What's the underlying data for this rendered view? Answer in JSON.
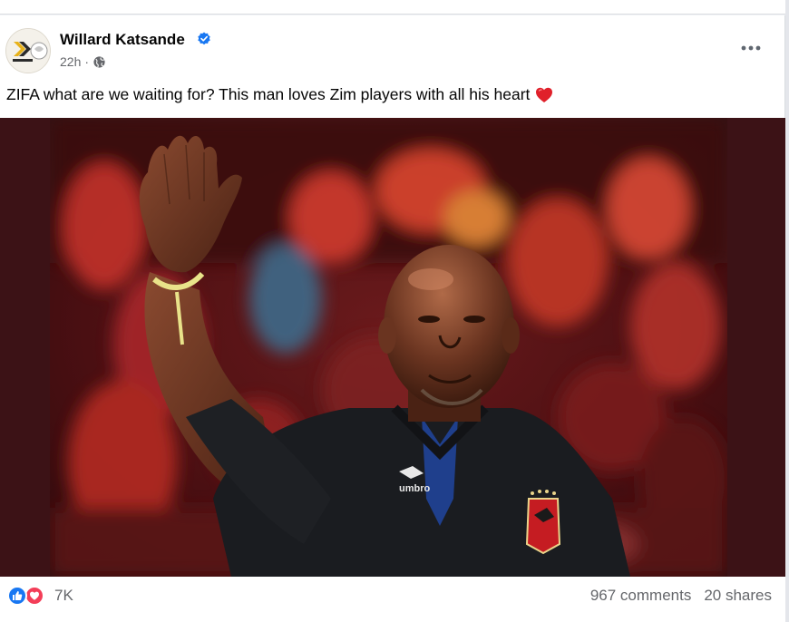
{
  "post": {
    "author": "Willard Katsande",
    "timestamp": "22h",
    "audience_icon": "globe-icon",
    "verified_icon": "verified-badge-icon",
    "text": "ZIFA what are we waiting for? This man loves Zim players with all his heart",
    "text_emoji": "red-heart-emoji",
    "avatar_logo": "K"
  },
  "reactions": {
    "icons": [
      "like-icon",
      "love-icon"
    ],
    "count": "7K"
  },
  "stats": {
    "comments": "967 comments",
    "shares": "20 shares"
  },
  "colors": {
    "brand_blue": "#1877f2",
    "love_red": "#f33e58",
    "secondary_text": "#65676b",
    "media_backdrop": "#3c1216"
  }
}
